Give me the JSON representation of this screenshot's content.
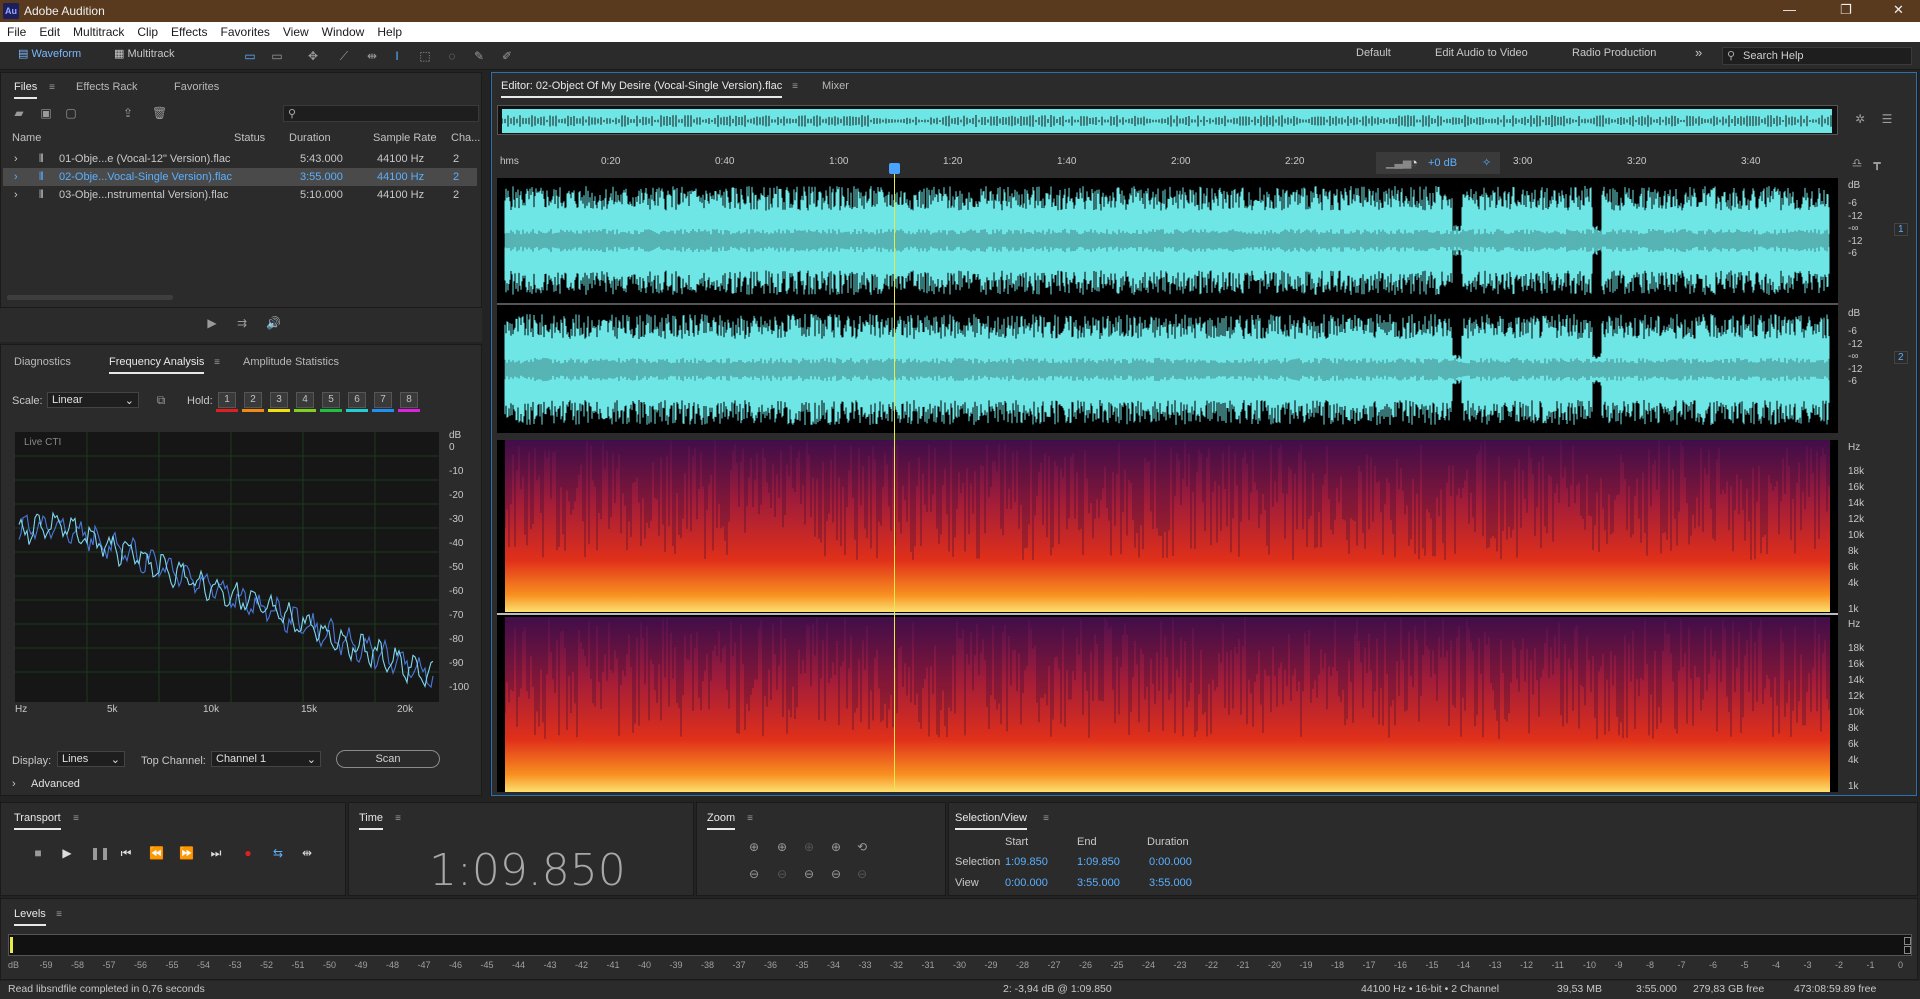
{
  "app": {
    "title": "Adobe Audition",
    "logo": "Au"
  },
  "menu": [
    "File",
    "Edit",
    "Multitrack",
    "Clip",
    "Effects",
    "Favorites",
    "View",
    "Window",
    "Help"
  ],
  "toolbar": {
    "waveform": "Waveform",
    "multitrack": "Multitrack",
    "workspaces": [
      "Default",
      "Edit Audio to Video",
      "Radio Production"
    ],
    "more": "»",
    "search_placeholder": "Search Help"
  },
  "files_panel": {
    "tabs": [
      "Files",
      "Effects Rack",
      "Favorites"
    ],
    "columns": [
      "Name",
      "Status",
      "Duration",
      "Sample Rate",
      "Cha..."
    ],
    "rows": [
      {
        "name": "01-Obje...e (Vocal-12\" Version).flac",
        "duration": "5:43.000",
        "rate": "44100 Hz",
        "channels": "2"
      },
      {
        "name": "02-Obje...Vocal-Single Version).flac",
        "duration": "3:55.000",
        "rate": "44100 Hz",
        "channels": "2"
      },
      {
        "name": "03-Obje...nstrumental Version).flac",
        "duration": "5:10.000",
        "rate": "44100 Hz",
        "channels": "2"
      }
    ]
  },
  "analysis_panel": {
    "tabs": [
      "Diagnostics",
      "Frequency Analysis",
      "Amplitude Statistics"
    ],
    "scale_label": "Scale:",
    "scale_value": "Linear",
    "hold_label": "Hold:",
    "holds": [
      "1",
      "2",
      "3",
      "4",
      "5",
      "6",
      "7",
      "8"
    ],
    "hold_colors": [
      "#e02020",
      "#f08a10",
      "#f0e010",
      "#80d020",
      "#20c040",
      "#20d0d0",
      "#2090f0",
      "#e020e0"
    ],
    "live": "Live CTI",
    "db_ticks": [
      "dB",
      "0",
      "-10",
      "-20",
      "-30",
      "-40",
      "-50",
      "-60",
      "-70",
      "-80",
      "-90",
      "-100"
    ],
    "hz_ticks": [
      "Hz",
      "5k",
      "10k",
      "15k",
      "20k"
    ],
    "display_label": "Display:",
    "display_value": "Lines",
    "topch_label": "Top Channel:",
    "topch_value": "Channel 1",
    "scan": "Scan",
    "advanced": "Advanced"
  },
  "editor": {
    "tab": "Editor: 02-Object Of My Desire (Vocal-Single Version).flac",
    "mixer": "Mixer",
    "timeline": [
      "hms",
      "0:20",
      "0:40",
      "1:00",
      "1:20",
      "1:40",
      "2:00",
      "2:20",
      "3:00",
      "3:20",
      "3:40"
    ],
    "gain": "+0 dB",
    "db_scale": [
      "dB",
      "-6",
      "-12",
      "-∞",
      "-12",
      "-6"
    ],
    "ch": [
      "1",
      "2"
    ],
    "hz_scale": [
      "Hz",
      "18k",
      "16k",
      "14k",
      "12k",
      "10k",
      "8k",
      "6k",
      "4k",
      "1k"
    ],
    "playhead_fraction": 0.2972
  },
  "transport": {
    "title": "Transport"
  },
  "time": {
    "title": "Time",
    "value": "1:09.850"
  },
  "zoom": {
    "title": "Zoom"
  },
  "selection": {
    "title": "Selection/View",
    "cols": [
      "Start",
      "End",
      "Duration"
    ],
    "selection_label": "Selection",
    "selection": [
      "1:09.850",
      "1:09.850",
      "0:00.000"
    ],
    "view_label": "View",
    "view": [
      "0:00.000",
      "3:55.000",
      "3:55.000"
    ]
  },
  "levels": {
    "title": "Levels",
    "ticks": [
      "dB",
      "-59",
      "-58",
      "-57",
      "-56",
      "-55",
      "-54",
      "-53",
      "-52",
      "-51",
      "-50",
      "-49",
      "-48",
      "-47",
      "-46",
      "-45",
      "-44",
      "-43",
      "-42",
      "-41",
      "-40",
      "-39",
      "-38",
      "-37",
      "-36",
      "-35",
      "-34",
      "-33",
      "-32",
      "-31",
      "-30",
      "-29",
      "-28",
      "-27",
      "-26",
      "-25",
      "-24",
      "-23",
      "-22",
      "-21",
      "-20",
      "-19",
      "-18",
      "-17",
      "-16",
      "-15",
      "-14",
      "-13",
      "-12",
      "-11",
      "-10",
      "-9",
      "-8",
      "-7",
      "-6",
      "-5",
      "-4",
      "-3",
      "-2",
      "-1",
      "0"
    ]
  },
  "status": {
    "left": "Read libsndfile completed in 0,76 seconds",
    "cursor": "2: -3,94 dB @ 1:09.850",
    "format": "44100 Hz • 16-bit • 2 Channel",
    "size": "39,53 MB",
    "duration": "3:55.000",
    "free": "279,83 GB free",
    "free_time": "473:08:59.89 free"
  },
  "colors": {
    "accent": "#5bb0ff",
    "waveform": "#6ee6e6",
    "title_bar": "#5a3a1e"
  }
}
